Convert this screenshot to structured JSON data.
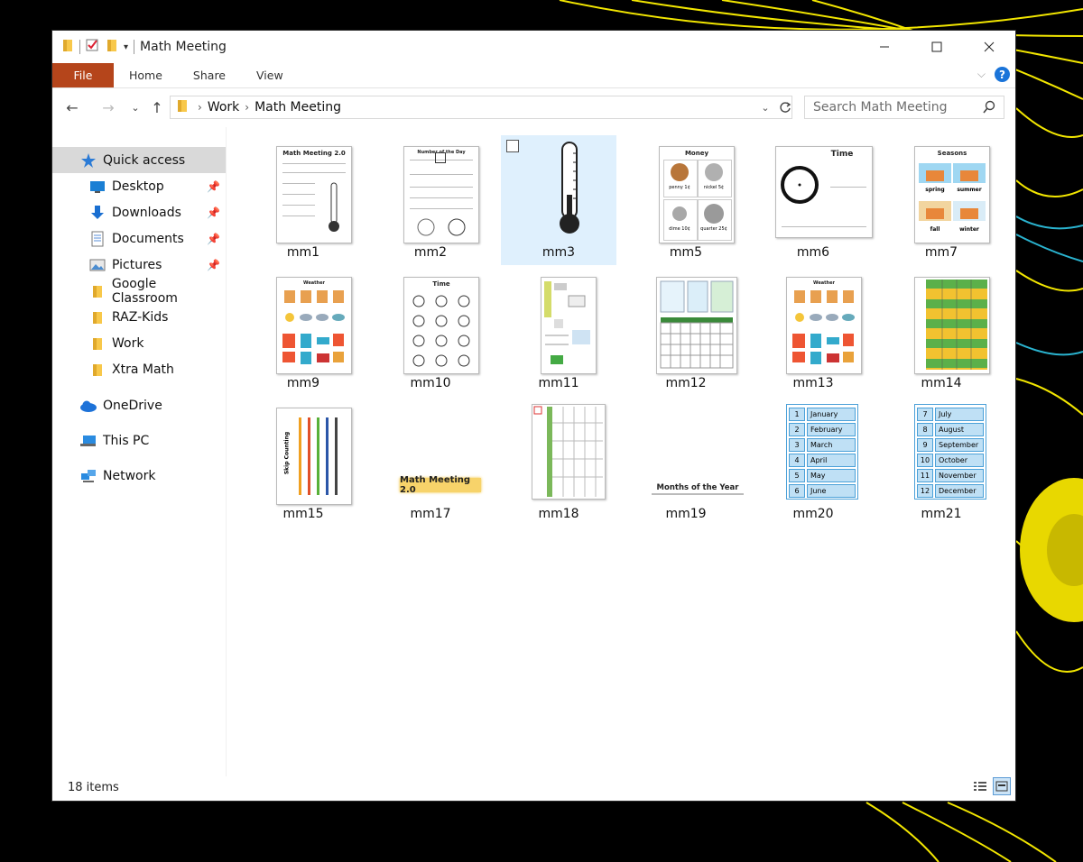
{
  "window": {
    "title": "Math Meeting",
    "minimize_icon": "minimize-icon",
    "maximize_icon": "maximize-icon",
    "close_icon": "close-icon"
  },
  "ribbon": {
    "tabs": [
      "File",
      "Home",
      "Share",
      "View"
    ]
  },
  "address": {
    "crumbs": [
      "Work",
      "Math Meeting"
    ],
    "search_placeholder": "Search Math Meeting"
  },
  "sidebar": {
    "items": [
      {
        "label": "Quick access",
        "icon": "star-icon",
        "pinned": false
      },
      {
        "label": "Desktop",
        "icon": "desktop-icon",
        "pinned": true
      },
      {
        "label": "Downloads",
        "icon": "download-icon",
        "pinned": true
      },
      {
        "label": "Documents",
        "icon": "documents-icon",
        "pinned": true
      },
      {
        "label": "Pictures",
        "icon": "pictures-icon",
        "pinned": true
      },
      {
        "label": "Google Classroom",
        "icon": "folder-icon",
        "pinned": false
      },
      {
        "label": "RAZ-Kids",
        "icon": "folder-icon",
        "pinned": false
      },
      {
        "label": "Work",
        "icon": "folder-icon",
        "pinned": false
      },
      {
        "label": "Xtra Math",
        "icon": "folder-icon",
        "pinned": false
      },
      {
        "label": "OneDrive",
        "icon": "cloud-icon",
        "pinned": false
      },
      {
        "label": "This PC",
        "icon": "computer-icon",
        "pinned": false
      },
      {
        "label": "Network",
        "icon": "network-icon",
        "pinned": false
      }
    ]
  },
  "files": [
    {
      "name": "mm1",
      "thumb_title": "Math Meeting 2.0"
    },
    {
      "name": "mm2",
      "thumb_title": "Number of the Day"
    },
    {
      "name": "mm3",
      "thumb_title": ""
    },
    {
      "name": "mm5",
      "thumb_title": "Money"
    },
    {
      "name": "mm6",
      "thumb_title": "Time"
    },
    {
      "name": "mm7",
      "thumb_title": "Seasons"
    },
    {
      "name": "mm9",
      "thumb_title": "Weather"
    },
    {
      "name": "mm10",
      "thumb_title": "Time"
    },
    {
      "name": "mm11",
      "thumb_title": ""
    },
    {
      "name": "mm12",
      "thumb_title": ""
    },
    {
      "name": "mm13",
      "thumb_title": "Weather"
    },
    {
      "name": "mm14",
      "thumb_title": ""
    },
    {
      "name": "mm15",
      "thumb_title": "Skip Counting"
    },
    {
      "name": "mm17",
      "thumb_title": "Math Meeting 2.0"
    },
    {
      "name": "mm18",
      "thumb_title": ""
    },
    {
      "name": "mm19",
      "thumb_title": "Months of the Year"
    },
    {
      "name": "mm20",
      "thumb_title": ""
    },
    {
      "name": "mm21",
      "thumb_title": ""
    }
  ],
  "thumb_text": {
    "money": [
      "penny 1¢",
      "nickel 5¢",
      "dime 10¢",
      "quarter 25¢"
    ],
    "seasons": [
      "spring",
      "summer",
      "fall",
      "winter"
    ],
    "months_a": [
      [
        "1",
        "January"
      ],
      [
        "2",
        "February"
      ],
      [
        "3",
        "March"
      ],
      [
        "4",
        "April"
      ],
      [
        "5",
        "May"
      ],
      [
        "6",
        "June"
      ]
    ],
    "months_b": [
      [
        "7",
        "July"
      ],
      [
        "8",
        "August"
      ],
      [
        "9",
        "September"
      ],
      [
        "10",
        "October"
      ],
      [
        "11",
        "November"
      ],
      [
        "12",
        "December"
      ]
    ]
  },
  "status": {
    "count": "18 items"
  },
  "colors": {
    "file_tab": "#b5451b",
    "selection": "#dff0fd",
    "help": "#1a74d9",
    "wallpaper_yellow": "#f2e600",
    "wallpaper_cyan": "#2ab3cf"
  }
}
